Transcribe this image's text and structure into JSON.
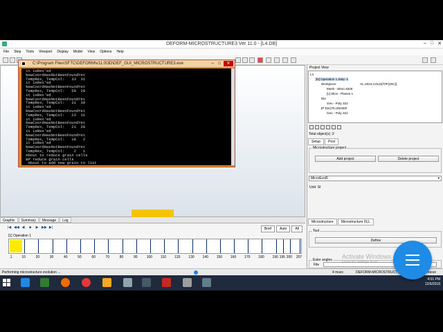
{
  "window": {
    "title": "DEFORM-MICROSTRUCTURE3  Ver 11.0 - [L4.DB]",
    "controls": [
      "–",
      "□",
      "✕"
    ]
  },
  "menu": [
    "File",
    "Step",
    "Tools",
    "Viewport",
    "Display",
    "Model",
    "View",
    "Options",
    "Help"
  ],
  "console": {
    "title": "C:\\Program Files\\SFTC\\DEFORM\\v11.0\\3D\\DEF_GUI_MICROSTRUCTURE3.exe",
    "lines": [
      " it isRex'ed",
      " NewCoordHasNotBeenFoundYet",
      " TempRex, TempCol:   33  31",
      " it isRex'ed",
      " NewCoordHasNotBeenFoundYet",
      " TempRex, TempCol:   50  20",
      " it isRex'ed",
      " NewCoordHasNotBeenFoundYet",
      " TempRex, TempCol:   31  39",
      " it isRex'ed",
      " NewCoordHasNotBeenFoundYet",
      " TempRex, TempCol:   23  31",
      " it isRex'ed",
      " NewCoordHasNotBeenFoundYet",
      " TempRex, TempCol:   21  28",
      " it isRex'ed",
      " NewCoordHasNotBeenFoundYet",
      " TempRex, TempCol:   18   2",
      " it isRex'ed",
      " NewCoordHasNotBeenFoundYet",
      " TempRex, TempCol:    2   1",
      " About to reduce grain cells",
      " BP reduce grain cells",
      "  About to add new grain to list",
      " debugcounter =     33628"
    ]
  },
  "viewport_tabs": [
    "Graphic",
    "Summary",
    "Message",
    "Log"
  ],
  "timeline": {
    "operation": "[1] Operation 1",
    "buttons": [
      "Brief",
      "Auto",
      "All"
    ],
    "tick_labels": [
      "1",
      "10",
      "20",
      "30",
      "40",
      "50",
      "60",
      "70",
      "80",
      "90",
      "100",
      "110",
      "120",
      "130",
      "140",
      "150",
      "160",
      "170",
      "180",
      "190",
      "195",
      "200",
      "207"
    ]
  },
  "status": {
    "left": "Performing microstructure evolution ...",
    "time": "4 msec",
    "right": "DEFORM-MICROSTRUCTURE",
    "far_right": "essor"
  },
  "project_view": {
    "header": "Project View",
    "tree": [
      {
        "text": "L4",
        "indent": 0
      },
      {
        "text": "[N] Operation 1  Step -1",
        "indent": 1
      },
      {
        "text": "Workpiece",
        "indent": 2
      },
      {
        "text": "AL-2024,COLD[70F(20C)]",
        "indent": 9
      },
      {
        "text": "Mesh - Elem 4928",
        "indent": 3
      },
      {
        "text": "[v] Slice - Planes 1",
        "indent": 3
      },
      {
        "text": "Die",
        "indent": 2
      },
      {
        "text": "Geo - Poly 322",
        "indent": 3
      },
      {
        "text": "[P:Die] PLUNGER",
        "indent": 2
      },
      {
        "text": "Geo - Poly 322",
        "indent": 3
      }
    ],
    "total_label": "Total object(s) :3"
  },
  "panel_tabs": [
    "Setup",
    "Post"
  ],
  "microstructure_project": {
    "group_label": "Microstructure project",
    "add_label": "Add project",
    "delete_label": "Delete project",
    "selected": "MicroEvol6",
    "unit_label": "Unit:",
    "unit_value": "SI"
  },
  "lower_tabs": [
    "Microstructure",
    "Microstructure DLL"
  ],
  "tool": {
    "group_label": "Tool",
    "define_label": "Define"
  },
  "euler": {
    "group_label": "Euler angles",
    "file_label": "File"
  },
  "watermark": {
    "line1": "Activate Windows",
    "line2": "Go to PC settings to ac"
  },
  "tray": {
    "time": "4:01 PM",
    "date": "12/6/2018"
  },
  "icons": {
    "fab": "menu-icon",
    "taskbar": [
      "windows-start-icon",
      "ie-browser-icon",
      "store-icon",
      "firefox-icon",
      "chrome-icon",
      "file-explorer-icon",
      "app-icon",
      "deform-icon",
      "tool-icon",
      "app2-icon",
      "app3-icon"
    ]
  },
  "colors": {
    "accent": "#1f8be4",
    "console_frame": "#e5881f",
    "workpiece": "#f5c400",
    "timeline_fill": "#ffea00"
  }
}
